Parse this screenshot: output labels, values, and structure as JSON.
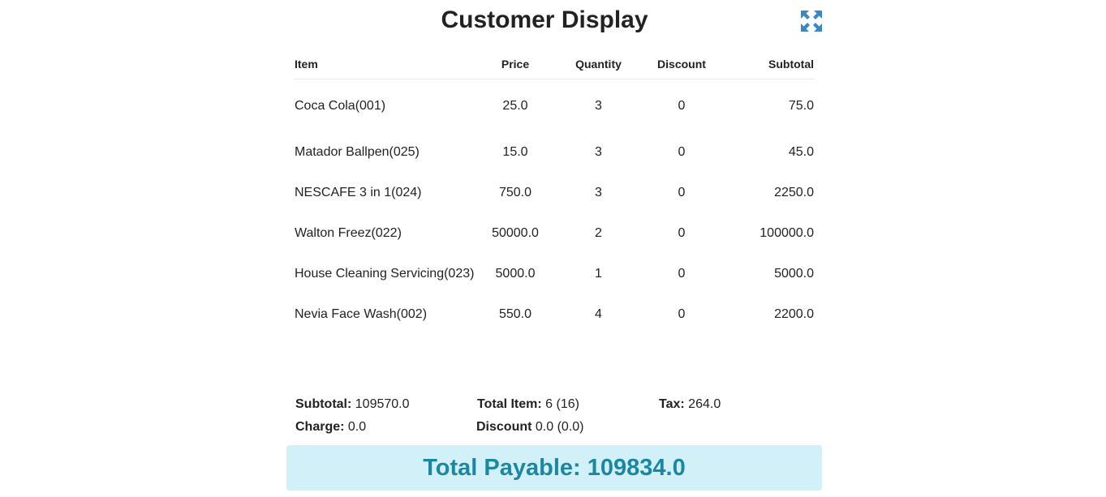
{
  "header": {
    "title": "Customer Display",
    "expand_icon": "expand-arrows-icon",
    "icon_color": "#3a87c4"
  },
  "table": {
    "columns": {
      "item": "Item",
      "price": "Price",
      "quantity": "Quantity",
      "discount": "Discount",
      "subtotal": "Subtotal"
    },
    "rows": [
      {
        "item": "Coca Cola(001)",
        "price": "25.0",
        "quantity": "3",
        "discount": "0",
        "subtotal": "75.0"
      },
      {
        "item": "Matador Ballpen(025)",
        "price": "15.0",
        "quantity": "3",
        "discount": "0",
        "subtotal": "45.0"
      },
      {
        "item": "NESCAFE 3 in 1(024)",
        "price": "750.0",
        "quantity": "3",
        "discount": "0",
        "subtotal": "2250.0"
      },
      {
        "item": "Walton Freez(022)",
        "price": "50000.0",
        "quantity": "2",
        "discount": "0",
        "subtotal": "100000.0"
      },
      {
        "item": "House Cleaning Servicing(023)",
        "price": "5000.0",
        "quantity": "1",
        "discount": "0",
        "subtotal": "5000.0"
      },
      {
        "item": "Nevia Face Wash(002)",
        "price": "550.0",
        "quantity": "4",
        "discount": "0",
        "subtotal": "2200.0"
      }
    ]
  },
  "summary": {
    "subtotal_label": "Subtotal:",
    "subtotal_value": "109570.0",
    "total_item_label": "Total Item:",
    "total_item_value": "6 (16)",
    "tax_label": "Tax:",
    "tax_value": "264.0",
    "charge_label": "Charge:",
    "charge_value": "0.0",
    "discount_label": "Discount",
    "discount_value": "0.0 (0.0)"
  },
  "total_payable": {
    "text": "Total Payable: 109834.0",
    "background": "#d2f0f8",
    "color": "#1b87a3"
  }
}
